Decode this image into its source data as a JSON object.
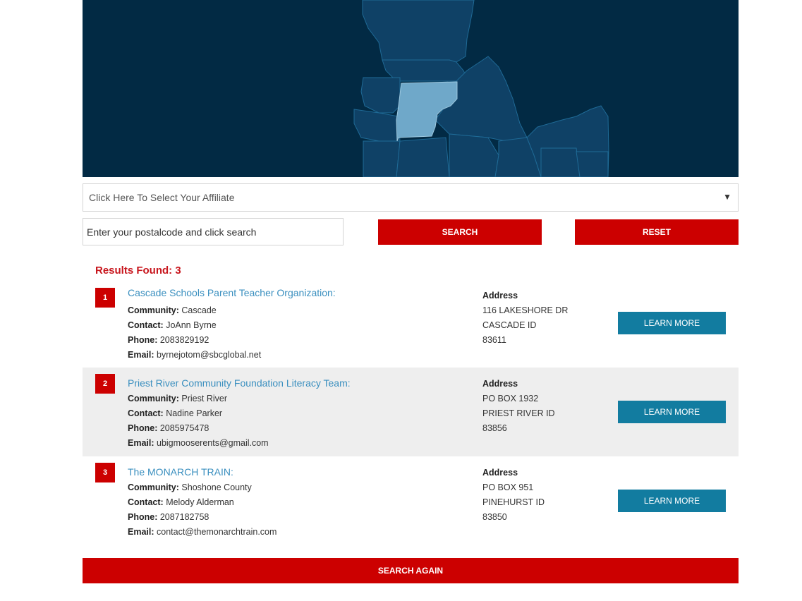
{
  "map": {
    "highlight_color": "#6fa8c9",
    "background_color": "#022a44"
  },
  "affiliate": {
    "placeholder": "Click Here To Select Your Affiliate",
    "arrow": "▼"
  },
  "postal": {
    "placeholder": "Enter your postalcode and click search"
  },
  "buttons": {
    "search": "SEARCH",
    "reset": "RESET",
    "search_again": "SEARCH AGAIN",
    "learn_more": "LEARN MORE"
  },
  "results": {
    "found_label": "Results Found: 3",
    "field_labels": {
      "community": "Community:",
      "contact": "Contact:",
      "phone": "Phone:",
      "email": "Email:",
      "address": "Address"
    },
    "items": [
      {
        "number": "1",
        "name": "Cascade Schools Parent Teacher Organization:",
        "community": "Cascade",
        "contact": "JoAnn Byrne",
        "phone": "2083829192",
        "email": "byrnejotom@sbcglobal.net",
        "address_line1": "116 LAKESHORE DR",
        "address_line2": "CASCADE ID",
        "address_line3": "83611"
      },
      {
        "number": "2",
        "name": "Priest River Community Foundation Literacy Team:",
        "community": "Priest River",
        "contact": "Nadine Parker",
        "phone": "2085975478",
        "email": "ubigmooserents@gmail.com",
        "address_line1": "PO BOX 1932",
        "address_line2": "PRIEST RIVER ID",
        "address_line3": "83856"
      },
      {
        "number": "3",
        "name": "The MONARCH TRAIN:",
        "community": "Shoshone County",
        "contact": "Melody Alderman",
        "phone": "2087182758",
        "email": "contact@themonarchtrain.com",
        "address_line1": "PO BOX 951",
        "address_line2": "PINEHURST ID",
        "address_line3": "83850"
      }
    ]
  }
}
